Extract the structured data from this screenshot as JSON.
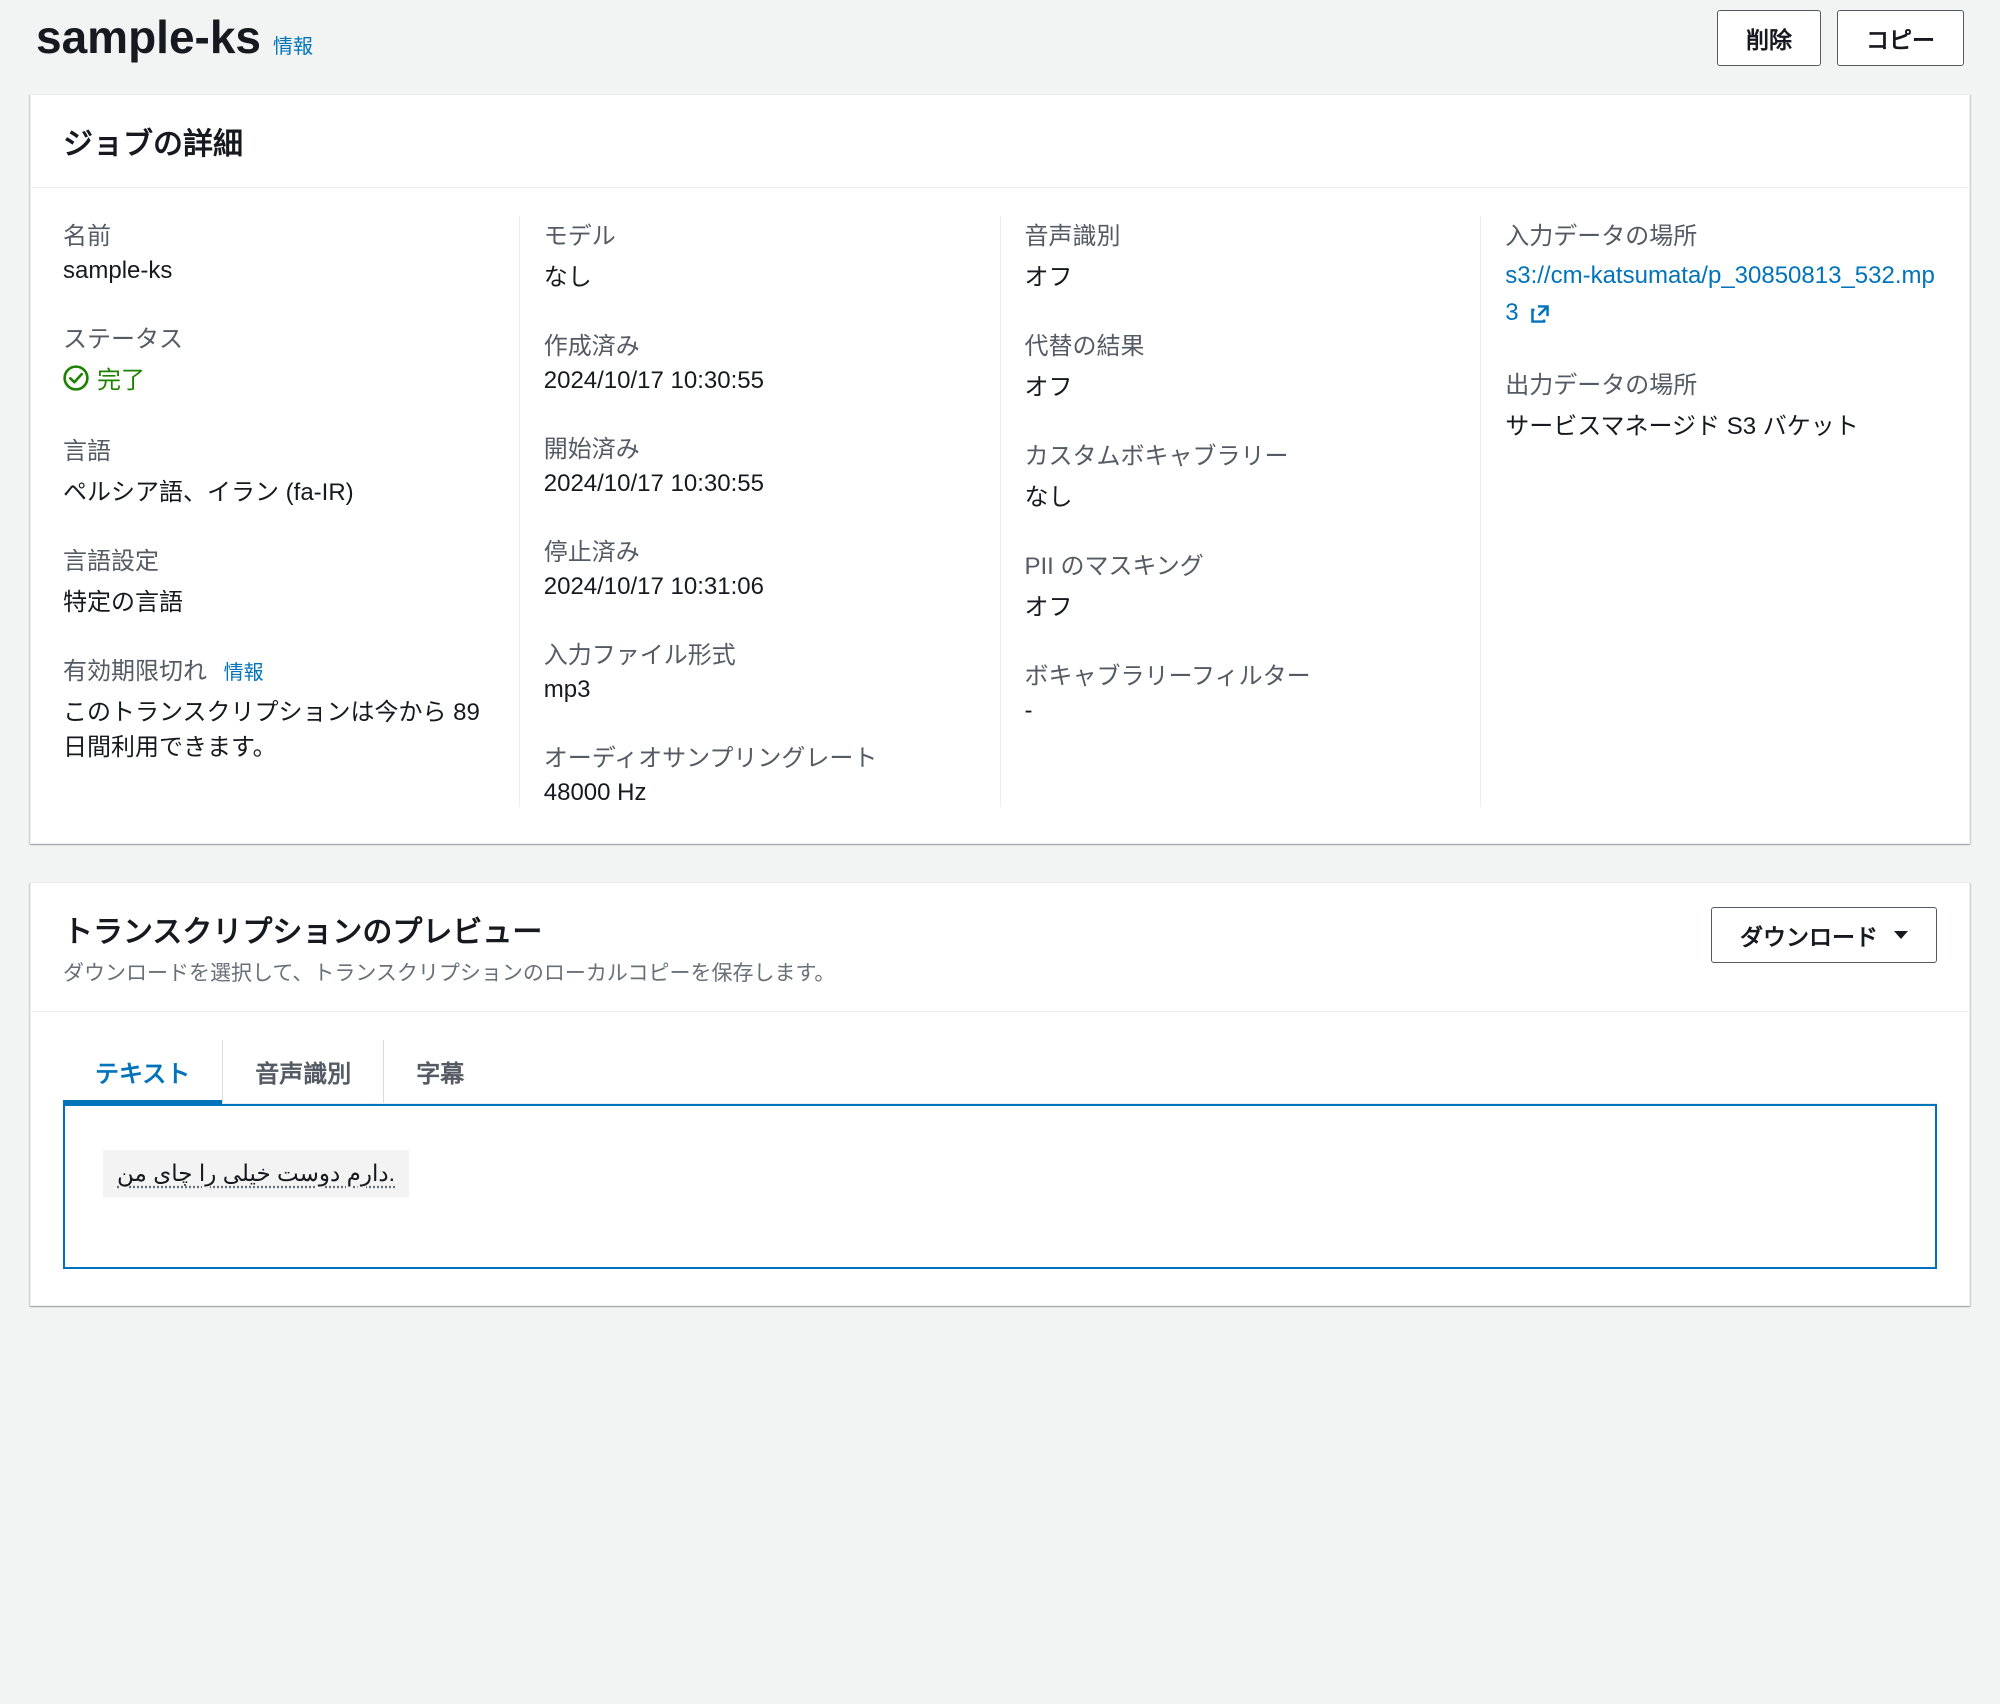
{
  "header": {
    "title": "sample-ks",
    "info_label": "情報",
    "actions": {
      "delete": "削除",
      "copy": "コピー"
    }
  },
  "details_panel": {
    "title": "ジョブの詳細",
    "col1": {
      "name_label": "名前",
      "name_value": "sample-ks",
      "status_label": "ステータス",
      "status_value": "完了",
      "language_label": "言語",
      "language_value": "ペルシア語、イラン (fa-IR)",
      "lang_setting_label": "言語設定",
      "lang_setting_value": "特定の言語",
      "expiry_label": "有効期限切れ",
      "expiry_info": "情報",
      "expiry_value": "このトランスクリプションは今から 89 日間利用できます。"
    },
    "col2": {
      "model_label": "モデル",
      "model_value": "なし",
      "created_label": "作成済み",
      "created_value": "2024/10/17 10:30:55",
      "started_label": "開始済み",
      "started_value": "2024/10/17 10:30:55",
      "stopped_label": "停止済み",
      "stopped_value": "2024/10/17 10:31:06",
      "input_format_label": "入力ファイル形式",
      "input_format_value": "mp3",
      "sampling_label": "オーディオサンプリングレート",
      "sampling_value": "48000 Hz"
    },
    "col3": {
      "speaker_label": "音声識別",
      "speaker_value": "オフ",
      "alt_label": "代替の結果",
      "alt_value": "オフ",
      "vocab_label": "カスタムボキャブラリー",
      "vocab_value": "なし",
      "pii_label": "PII のマスキング",
      "pii_value": "オフ",
      "filter_label": "ボキャブラリーフィルター",
      "filter_value": "-"
    },
    "col4": {
      "input_loc_label": "入力データの場所",
      "input_loc_value": "s3://cm-katsumata/p_30850813_532.mp3",
      "output_loc_label": "出力データの場所",
      "output_loc_value": "サービスマネージド S3 バケット"
    }
  },
  "preview_panel": {
    "title": "トランスクリプションのプレビュー",
    "subtitle": "ダウンロードを選択して、トランスクリプションのローカルコピーを保存します。",
    "download_label": "ダウンロード",
    "tabs": {
      "text": "テキスト",
      "speaker": "音声識別",
      "subtitle": "字幕"
    },
    "transcript_text": ".دارم دوست خیلی را چای من"
  }
}
